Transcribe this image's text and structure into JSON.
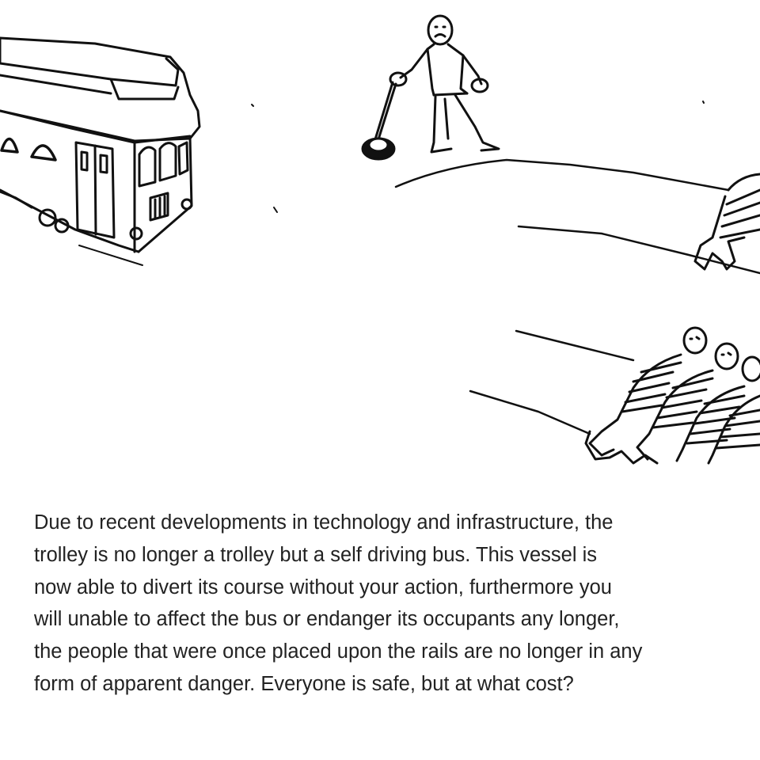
{
  "caption": {
    "text": "Due to recent developments in technology and infrastructure, the\ntrolley is no longer a trolley but a self driving bus.  This vessel is\nnow able to divert its course without your action, furthermore you\nwill unable to affect the bus or endanger its occupants any longer,\nthe people that were once placed upon the rails are no longer in any\nform of apparent danger.  Everyone is safe, but at what cost?"
  },
  "illustration": {
    "items": [
      "trolley-car",
      "person-at-lever",
      "track-lever",
      "upper-track",
      "lower-track",
      "single-person-on-track",
      "five-people-on-track"
    ]
  }
}
